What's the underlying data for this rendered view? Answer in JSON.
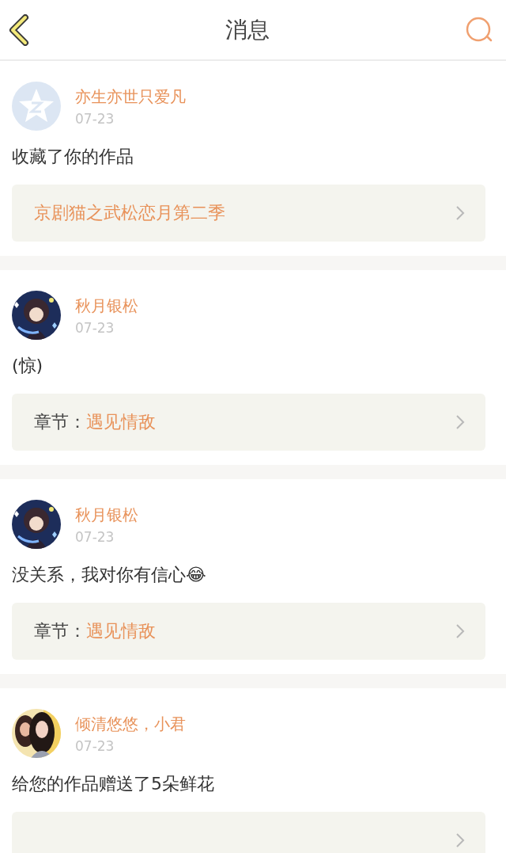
{
  "header": {
    "title": "消息"
  },
  "messages": [
    {
      "avatar": {
        "kind": "default"
      },
      "name": "亦生亦世只爱凡",
      "date": "07-23",
      "text": "收藏了你的作品",
      "link": {
        "kind": "work",
        "title": "京剧猫之武松恋月第二季"
      }
    },
    {
      "name": "秋月银松",
      "date": "07-23",
      "text": "(惊)",
      "link": {
        "kind": "chapter",
        "label": "章节：",
        "title": "遇见情敌"
      }
    },
    {
      "name": "秋月银松",
      "date": "07-23",
      "text": "没关系，我对你有信心😂",
      "link": {
        "kind": "chapter",
        "label": "章节：",
        "title": "遇见情敌"
      }
    },
    {
      "name": "倾清悠悠，小君",
      "date": "07-23",
      "text": "给您的作品赠送了5朵鲜花",
      "link": {
        "kind": "work"
      }
    }
  ]
}
